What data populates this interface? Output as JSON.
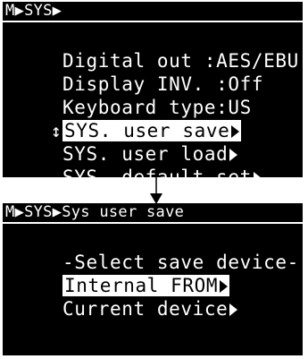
{
  "screen_top": {
    "title": "M▶SYS▶",
    "rows": [
      {
        "cursor": "",
        "text": "Digital out :AES/EBU",
        "has_arrow": false
      },
      {
        "cursor": "",
        "text": "Display INV. :Off",
        "has_arrow": false
      },
      {
        "cursor": "",
        "text": "Keyboard type:US",
        "has_arrow": false
      },
      {
        "cursor": "↕",
        "text": "SYS. user save",
        "has_arrow": true,
        "selected": true
      },
      {
        "cursor": "",
        "text": "SYS. user load",
        "has_arrow": true
      },
      {
        "cursor": "",
        "text": "SYS. default set",
        "has_arrow": true
      }
    ]
  },
  "screen_bottom": {
    "title": "M▶SYS▶Sys user save",
    "rows": [
      {
        "cursor": "",
        "text": "-Select save device-",
        "has_arrow": false
      },
      {
        "cursor": "",
        "text": "Internal FROM",
        "has_arrow": true,
        "selected": true
      },
      {
        "cursor": "",
        "text": "Current device",
        "has_arrow": true
      }
    ]
  },
  "colors": {
    "lcd_background": "#000000",
    "lcd_foreground": "#ffffff",
    "page_background": "#ffffff"
  },
  "icons": {
    "cursor": "up-down-cursor-icon",
    "submenu": "submenu-arrow-icon",
    "transition": "down-arrow-icon"
  }
}
